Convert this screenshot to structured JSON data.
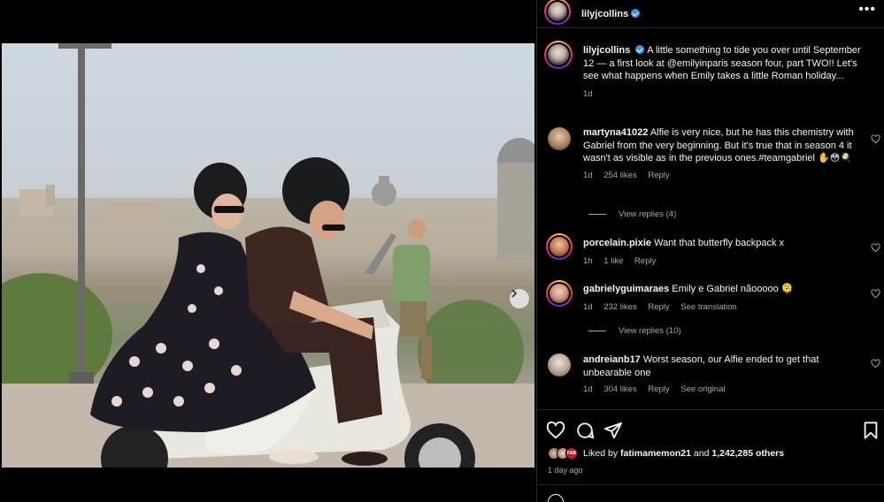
{
  "post": {
    "author": "lilyjcollins",
    "caption": "A little something to tide you over until September 12 — a first look at @emilyinparis season four, part TWO!! Let's see what happens when Emily takes a little Roman holiday...",
    "caption_time": "1d",
    "likes_label": "Liked by",
    "liked_by_user": "fatimamemon21",
    "likes_and": "and",
    "likes_count": "1,242,285 others",
    "posted_ago": "1 day ago",
    "story_badge": "FAB"
  },
  "comments": [
    {
      "username": "martyna41022",
      "text": "Alfie is very nice, but he has this chemistry with Gabriel from the very beginning. But it's true that in season 4 it wasn't as visible as in the previous ones.#teamgabriel ✋😳🍳",
      "time": "1d",
      "likes": "254 likes",
      "reply": "Reply",
      "replies": "View replies (4)"
    },
    {
      "username": "porcelain.pixie",
      "text": "Want that butterfly backpack x",
      "time": "1h",
      "likes": "1 like",
      "reply": "Reply"
    },
    {
      "username": "gabrielyguimaraes",
      "text": "Emily e Gabriel nãooooo 🫠",
      "time": "1d",
      "likes": "232 likes",
      "reply": "Reply",
      "extra": "See translation",
      "replies": "View replies (10)"
    },
    {
      "username": "andreianb17",
      "text": "Worst season, our Alfie ended to get that unbearable one",
      "time": "1d",
      "likes": "304 likes",
      "reply": "Reply",
      "extra": "See original"
    }
  ],
  "carousel": {
    "count": 7,
    "active_index": 0
  },
  "icons": {
    "more": "more-options-icon",
    "heart": "heart-icon",
    "comment": "comment-icon",
    "share": "share-icon",
    "save": "bookmark-icon",
    "next": "chevron-right-icon",
    "emoji": "emoji-icon"
  },
  "colors": {
    "accent": "#3797f0",
    "muted": "#a8a8a8",
    "background": "#000000"
  }
}
